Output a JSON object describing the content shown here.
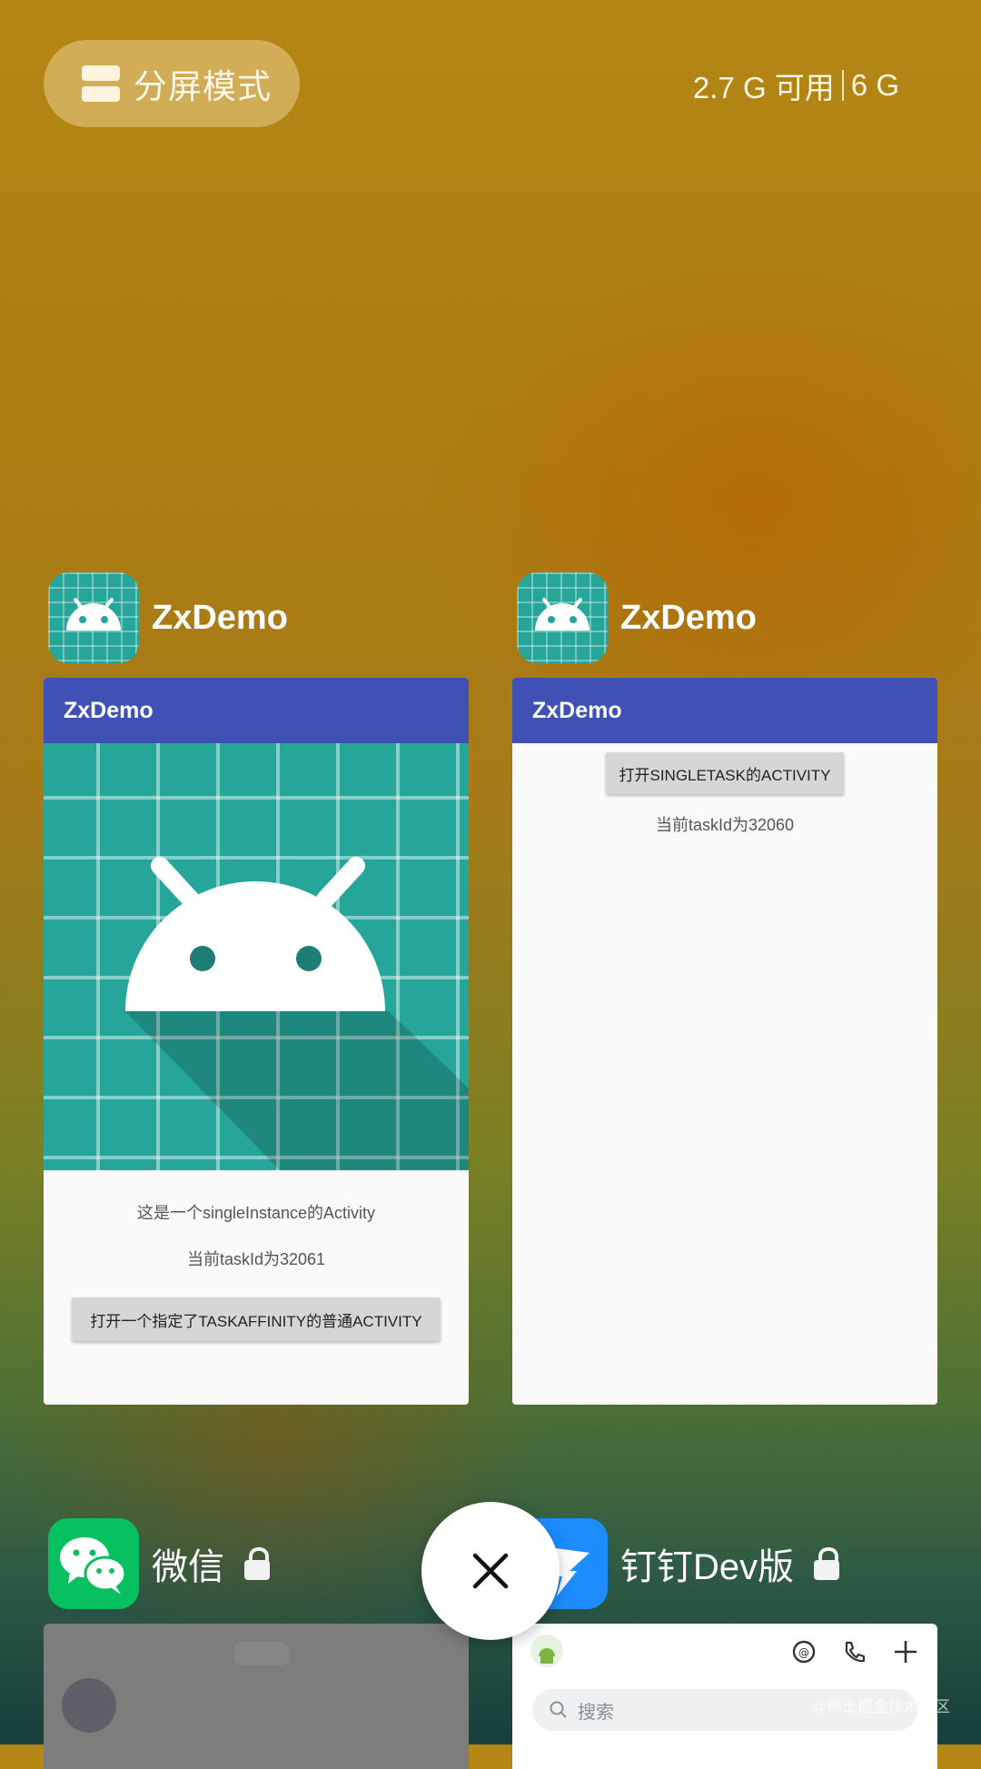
{
  "top_bar": {
    "split_screen_label": "分屏模式",
    "memory_available": "2.7 G 可用",
    "memory_total": "6 G"
  },
  "colors": {
    "app_bar": "#3f51b5",
    "android_teal": "#26a69a",
    "wechat_green": "#07c160",
    "dingtalk_blue": "#1d8cff"
  },
  "recent_apps": [
    {
      "name": "ZxDemo",
      "icon": "android-icon",
      "card": {
        "app_bar_title": "ZxDemo",
        "text1": "这是一个singleInstance的Activity",
        "text2": "当前taskId为32061",
        "button": "打开一个指定了TASKAFFINITY的普通ACTIVITY"
      }
    },
    {
      "name": "ZxDemo",
      "icon": "android-icon",
      "card": {
        "app_bar_title": "ZxDemo",
        "button": "打开SINGLETASK的ACTIVITY",
        "text1": "当前taskId为32060"
      }
    },
    {
      "name": "微信",
      "icon": "wechat-icon",
      "locked": true
    },
    {
      "name": "钉钉Dev版",
      "icon": "dingtalk-icon",
      "locked": true,
      "card": {
        "search_placeholder": "搜索"
      }
    }
  ],
  "close_all_icon": "close-icon",
  "watermark": "@稀土掘金技术社区"
}
